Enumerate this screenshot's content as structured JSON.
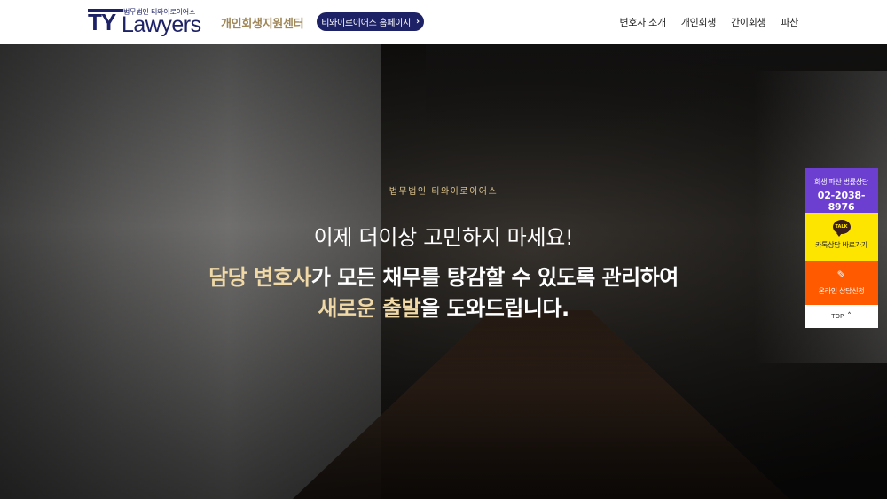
{
  "header": {
    "logo_mark": "TY",
    "logo_subtitle": "법무법인 티와이로이어스",
    "logo_main": "Lawyers",
    "center_name": "개인회생지원센터",
    "home_button": "티와이로이어스 홈페이지",
    "home_button_icon": "chevron-right-icon",
    "nav": [
      "변호사 소개",
      "개인회생",
      "간이회생",
      "파산"
    ]
  },
  "hero": {
    "kicker": "법무법인 티와이로이어스",
    "line1": "이제 더이상 고민하지 마세요!",
    "line2_highlight": "담당 변호사",
    "line2_rest": "가 모든 채무를 탕감할 수 있도록 관리하여",
    "line3_highlight": "새로운 출발",
    "line3_rest": "을 도와드립니다."
  },
  "quick_menu": {
    "phone_label": "회생·파산 법률상담",
    "phone_number": "02-2038-8976",
    "kakao_icon_text": "TALK",
    "kakao_label": "카톡상담 바로가기",
    "online_icon": "pencil-icon",
    "online_label": "온라인 상담신청",
    "top_label": "TOP",
    "top_icon": "chevron-up-icon"
  },
  "colors": {
    "brand_navy": "#1d2166",
    "gold": "#a08758",
    "highlight": "#f0d9a6",
    "phone_bg": "#6c3fd1",
    "kakao_bg": "#fee500",
    "online_bg": "#ff5a00"
  }
}
